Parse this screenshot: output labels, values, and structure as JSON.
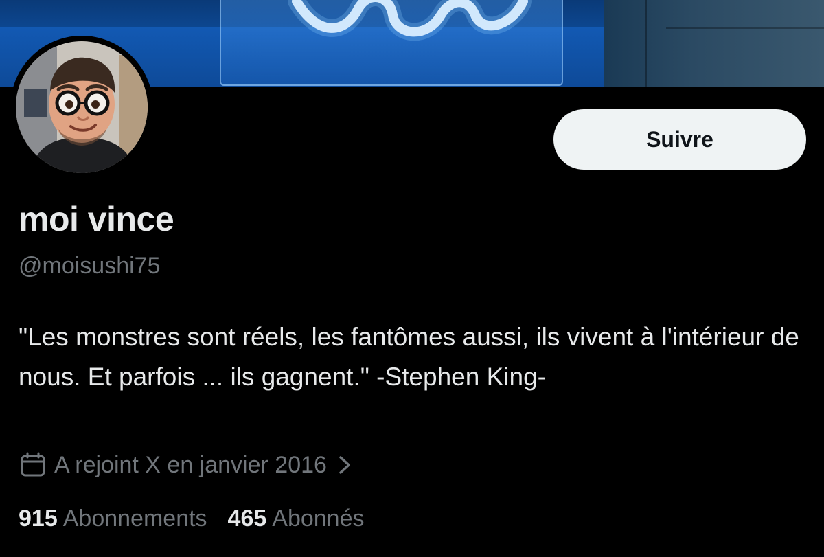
{
  "profile": {
    "display_name": "moi vince",
    "handle": "@moisushi75",
    "bio": "\"Les monstres sont réels, les fantômes aussi, ils vivent à l'intérieur de nous. Et parfois ... ils gagnent.\" -Stephen King-",
    "joined": "A rejoint X en janvier 2016",
    "follow_label": "Suivre"
  },
  "stats": {
    "following_count": "915",
    "following_label": "Abonnements",
    "followers_count": "465",
    "followers_label": "Abonnés"
  },
  "colors": {
    "background": "#000000",
    "primary_text": "#e7e9ea",
    "secondary_text": "#71767b",
    "button_bg": "#eff3f4"
  },
  "icons": {
    "calendar": "calendar-icon",
    "chevron": "chevron-right-icon"
  }
}
